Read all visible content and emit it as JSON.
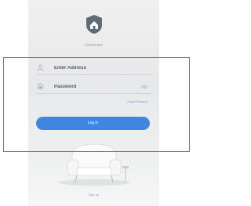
{
  "app": {
    "brand_name": "Livehome",
    "logo_icon": "home-shield-icon"
  },
  "login_form": {
    "email": {
      "placeholder": "Enter Address",
      "value": "",
      "icon": "user-icon"
    },
    "password": {
      "placeholder": "Password",
      "value": "",
      "icon": "lock-icon",
      "toggle_icon": "eye-icon"
    },
    "forgot_password_label": "Forgot Password",
    "login_button_label": "Log in",
    "signup_label": "Sign up"
  },
  "colors": {
    "accent": "#3f86e0",
    "link": "#7a9ec9",
    "highlight_box": "#e54646"
  }
}
